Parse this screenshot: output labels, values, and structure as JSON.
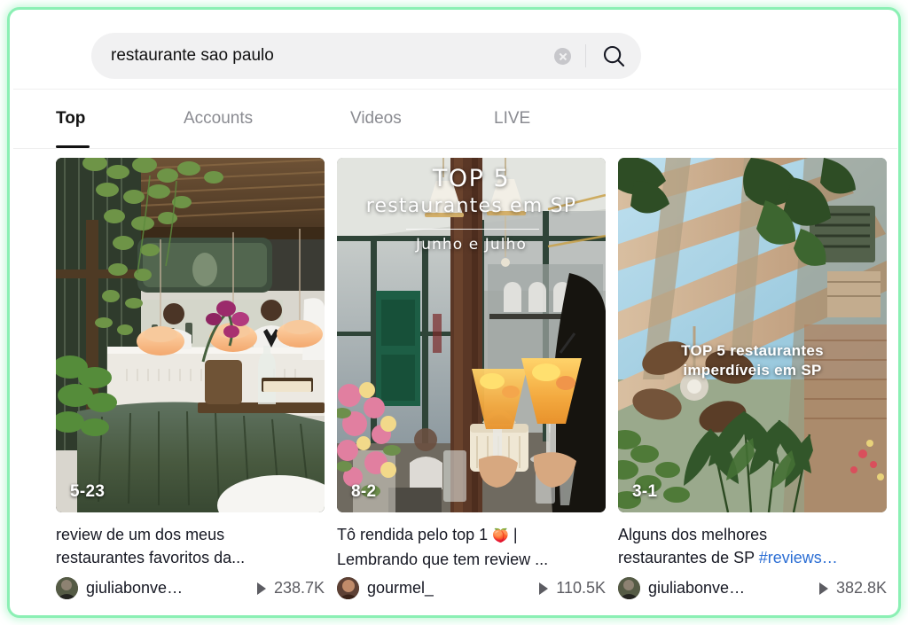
{
  "search": {
    "value": "restaurante sao paulo",
    "placeholder": "Search",
    "clear_label": "",
    "search_icon": "search-icon",
    "clear_icon": "clear-circle-icon"
  },
  "tabs": [
    {
      "label": "Top",
      "active": true
    },
    {
      "label": "Accounts",
      "active": false
    },
    {
      "label": "Videos",
      "active": false
    },
    {
      "label": "LIVE",
      "active": false
    }
  ],
  "results": [
    {
      "date_badge": "5-23",
      "caption_line1": "review de um dos meus",
      "caption_line2": "restaurantes favoritos da...",
      "author": "giuliabonve…",
      "views": "238.7K",
      "overlay": [],
      "scene": "restaurant-interior-green-banquette"
    },
    {
      "date_badge": "8-2",
      "caption_line1": "Tô rendida pelo top 1",
      "caption_emoji": "🍑",
      "caption_line1_tail": "|",
      "caption_line2": "Lembrando que tem review ...",
      "author": "gourmel_",
      "views": "110.5K",
      "overlay": [
        "TOP 5",
        "restaurantes em SP",
        "Junho e Julho"
      ],
      "scene": "cocktail-toast-window-flowers"
    },
    {
      "date_badge": "3-1",
      "caption_line1": "Alguns dos melhores",
      "caption_line2": "restaurantes de SP",
      "caption_hashtag": "#reviews…",
      "author": "giuliabonve…",
      "views": "382.8K",
      "overlay": [
        "TOP 5 restaurantes",
        "imperdíveis em SP"
      ],
      "scene": "greenhouse-glass-roof-fan-palms"
    }
  ],
  "colors": {
    "frame_accent": "#8bf0b4",
    "search_field_bg": "#f1f1f2",
    "text_primary": "#161823",
    "text_muted": "#8a8b91",
    "hashtag_blue": "#2b6ed4"
  }
}
